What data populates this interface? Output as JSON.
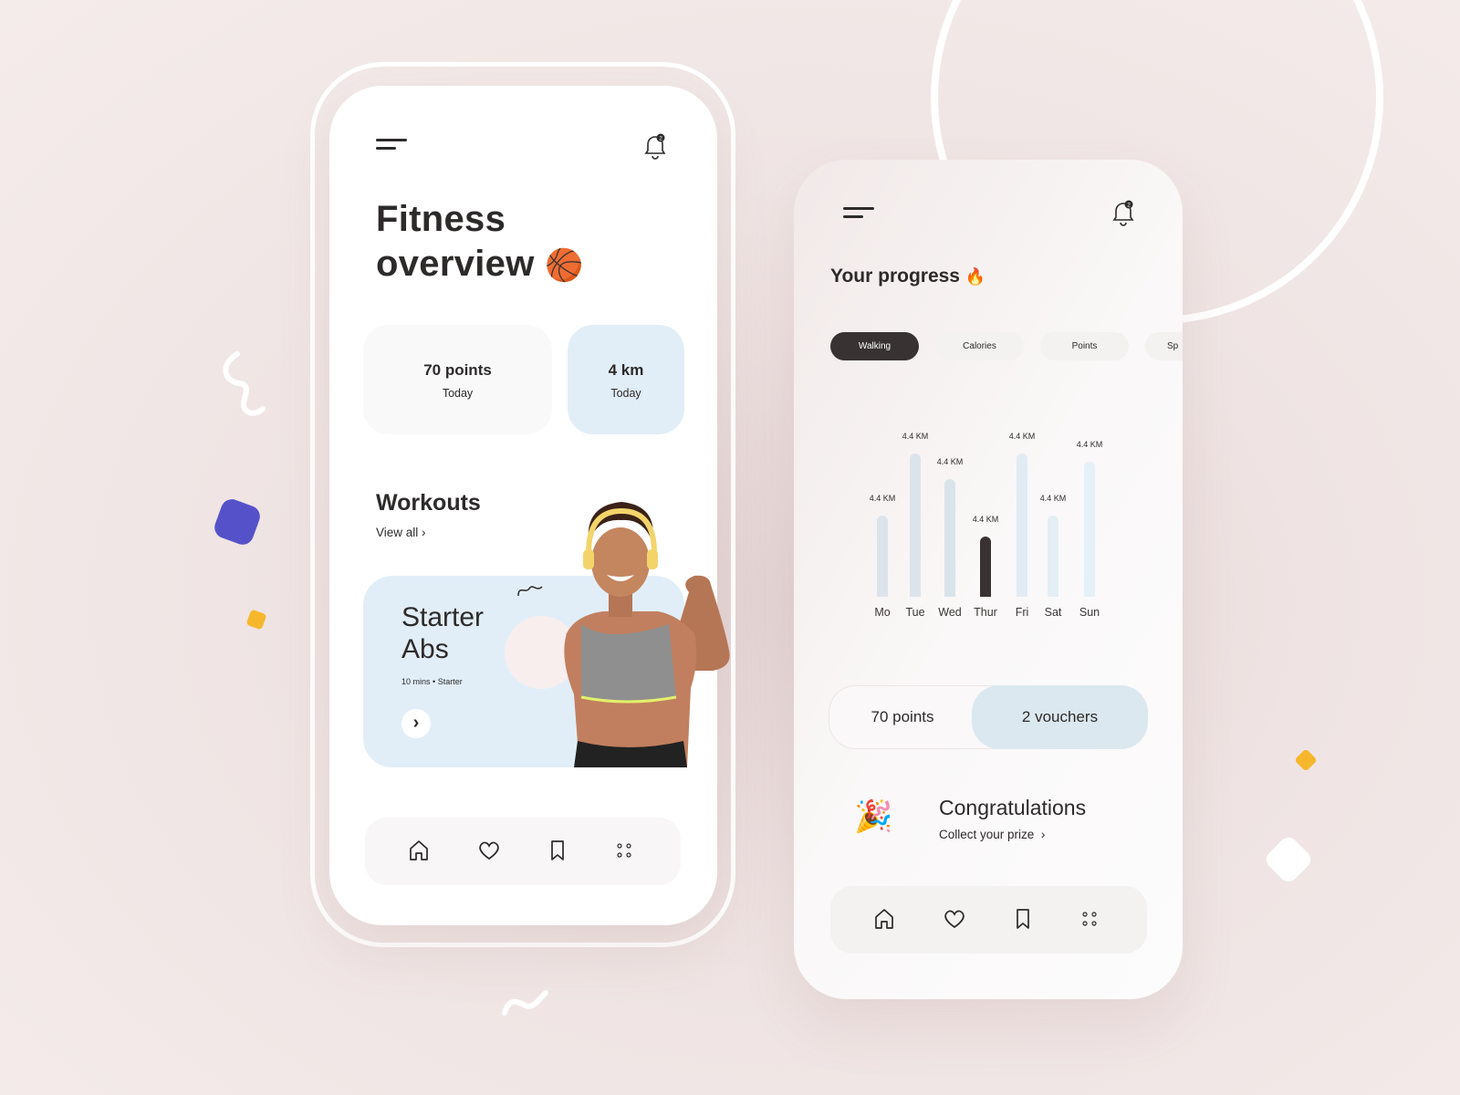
{
  "colors": {
    "accent_dark": "#383232",
    "light_blue": "#e1eef8",
    "purple": "#5552c9",
    "yellow": "#f6b72c"
  },
  "left_phone": {
    "menu_icon": "hamburger-icon",
    "notification_icon": "bell-icon",
    "notification_count": "2",
    "title_line1": "Fitness",
    "title_line2": "overview",
    "title_emoji": "🏀",
    "stats": [
      {
        "value": "70 points",
        "label": "Today"
      },
      {
        "value": "4 km",
        "label": "Today"
      }
    ],
    "workouts": {
      "heading": "Workouts",
      "view_all": "View all",
      "chevron": "›"
    },
    "workout_card": {
      "title_line1": "Starter",
      "title_line2": "Abs",
      "duration": "10 mins",
      "separator": "•",
      "level": "Starter",
      "arrow": "›"
    },
    "bottom_nav": [
      "home-icon",
      "heart-icon",
      "bookmark-icon",
      "grid-icon"
    ]
  },
  "right_phone": {
    "menu_icon": "hamburger-icon",
    "notification_icon": "bell-icon",
    "notification_count": "2",
    "title": "Your progress",
    "title_emoji": "🔥",
    "tabs": [
      {
        "label": "Walking",
        "active": true
      },
      {
        "label": "Calories"
      },
      {
        "label": "Points"
      },
      {
        "label": "Sp"
      }
    ],
    "stats": {
      "points": "70 points",
      "vouchers": "2 vouchers"
    },
    "congrats": {
      "emoji": "🎉",
      "title": "Congratulations",
      "link": "Collect your prize",
      "chevron": "›"
    },
    "bottom_nav": [
      "home-icon",
      "heart-icon",
      "bookmark-icon",
      "grid-icon"
    ]
  },
  "chart_data": {
    "type": "bar",
    "categories": [
      "Mo",
      "Tue",
      "Wed",
      "Thur",
      "Fri",
      "Sat",
      "Sun"
    ],
    "data_labels": [
      "4.4 KM",
      "4.4 KM",
      "4.4 KM",
      "4.4 KM",
      "4.4 KM",
      "4.4 KM",
      "4.4 KM"
    ],
    "relative_levels": [
      0.57,
      1.0,
      0.82,
      0.42,
      1.0,
      0.57,
      0.94
    ],
    "highlighted": "Thur",
    "bar_colors": [
      "#dde3ea",
      "#dde3ea",
      "#d9e3ea",
      "#383232",
      "#e1ebf3",
      "#e3eef5",
      "#e5f0f7"
    ],
    "grid": false
  }
}
